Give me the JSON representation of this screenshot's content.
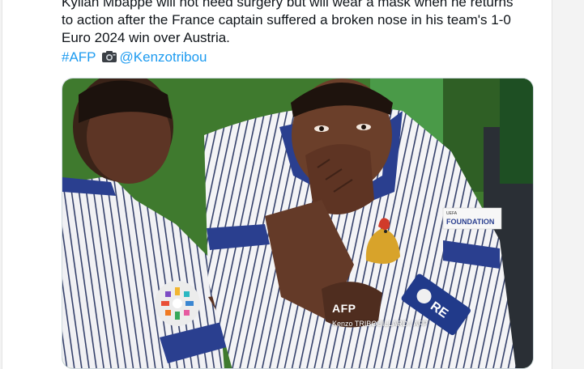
{
  "post": {
    "text_lines": [
      "Kylian Mbappe will not need surgery but will wear a mask when he returns",
      "to action after the France captain suffered a broken nose in his team's 1-0",
      "Euro 2024 win over Austria."
    ],
    "hashtag": "#AFP",
    "camera_icon": "camera-emoji",
    "mention": "@Kenzotribou"
  },
  "media": {
    "watermark_logo": "AFP",
    "photo_credit": "Kenzo TRIBOUILLARD / AFP",
    "sleeve_badge_text": "FOUNDATION",
    "sleeve_badge_top": "UEFA",
    "armband_text": "RE",
    "colors": {
      "grass": "#3f7a2e",
      "shirt": "#f4f4f6",
      "stripe": "#33406a",
      "navy_trim": "#2a3f8f",
      "skin": "#6b3f2a"
    }
  }
}
